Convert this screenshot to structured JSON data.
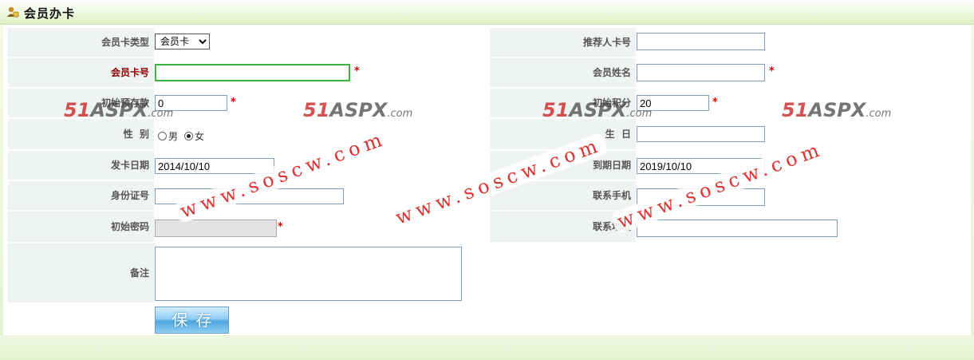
{
  "header": {
    "title": "会员办卡"
  },
  "form": {
    "card_type_label": "会员卡类型",
    "card_type_value": "会员卡",
    "card_no_label": "会员卡号",
    "card_no_value": "",
    "deposit_label": "初始预存款",
    "deposit_value": "0",
    "gender_label": "性  别",
    "gender_male": "男",
    "gender_female": "女",
    "gender_selected": "女",
    "issue_date_label": "发卡日期",
    "issue_date_value": "2014/10/10",
    "id_no_label": "身份证号",
    "id_no_value": "",
    "password_label": "初始密码",
    "password_value": "",
    "memo_label": "备注",
    "memo_value": "",
    "referrer_label": "推荐人卡号",
    "referrer_value": "",
    "name_label": "会员姓名",
    "name_value": "",
    "points_label": "初始积分",
    "points_value": "20",
    "birthday_label": "生  日",
    "birthday_value": "",
    "expire_date_label": "到期日期",
    "expire_date_value": "2019/10/10",
    "phone_label": "联系手机",
    "phone_value": "",
    "address_label": "联系地址",
    "address_value": "",
    "required_mark": "*",
    "save_label": "保存"
  },
  "watermarks": {
    "logo_main": "51",
    "logo_aspx": "ASPX",
    "logo_com": ".com",
    "url_text": "www.soscw.com"
  },
  "colors": {
    "required": "#e00000",
    "label_bg": "#eff3f1",
    "focus_border": "#3bb43b",
    "header_bg": "#eef8df"
  }
}
